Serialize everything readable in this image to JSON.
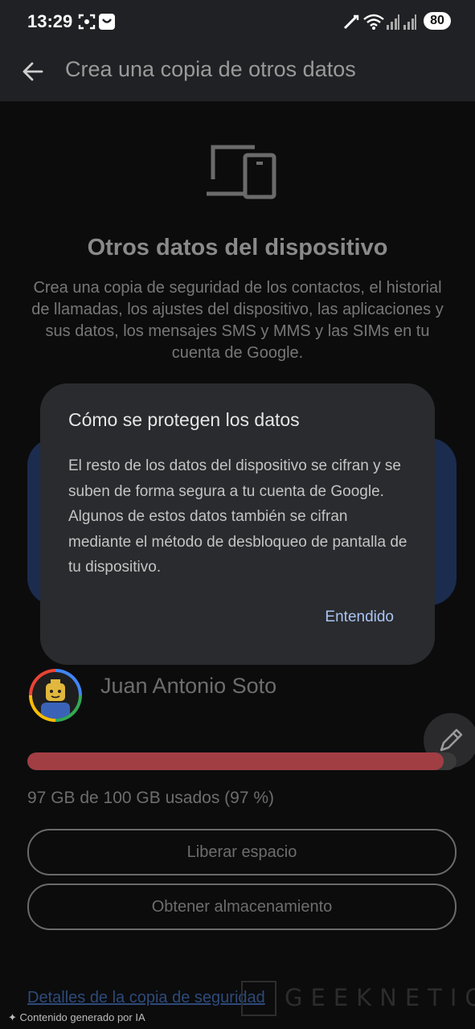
{
  "status_bar": {
    "time": "13:29",
    "battery": "80"
  },
  "app_bar": {
    "title": "Crea una copia de otros datos",
    "back_icon": "arrow-back-icon"
  },
  "section": {
    "icon": "devices-icon",
    "title": "Otros datos del dispositivo",
    "description": "Crea una copia de seguridad de los contactos, el historial de llamadas, los ajustes del dispositivo, las aplicaciones y sus datos, los mensajes SMS y MMS y las SIMs en tu cuenta de Google."
  },
  "dialog": {
    "title": "Cómo se protegen los datos",
    "body": "El resto de los datos del dispositivo se cifran y se suben de forma segura a tu cuenta de Google. Algunos de estos datos también se cifran mediante el método de desbloqueo de pantalla de tu dispositivo.",
    "confirm_label": "Entendido"
  },
  "account": {
    "name": "Juan Antonio Soto",
    "edit_icon": "pencil-icon"
  },
  "storage": {
    "text": "97 GB de 100 GB usados (97 %)",
    "used_fraction": 0.97,
    "bar_color": "#a13e44"
  },
  "buttons": {
    "free_space": "Liberar espacio",
    "get_storage": "Obtener almacenamiento"
  },
  "details_link": "Detalles de la copia de seguridad",
  "watermark": "GEEKNETIC",
  "ai_caption": "Contenido generado por IA",
  "colors": {
    "accent": "#a9c4f5",
    "dialog_bg": "#2a2b2e",
    "card_blue": "#1b2c4f"
  }
}
